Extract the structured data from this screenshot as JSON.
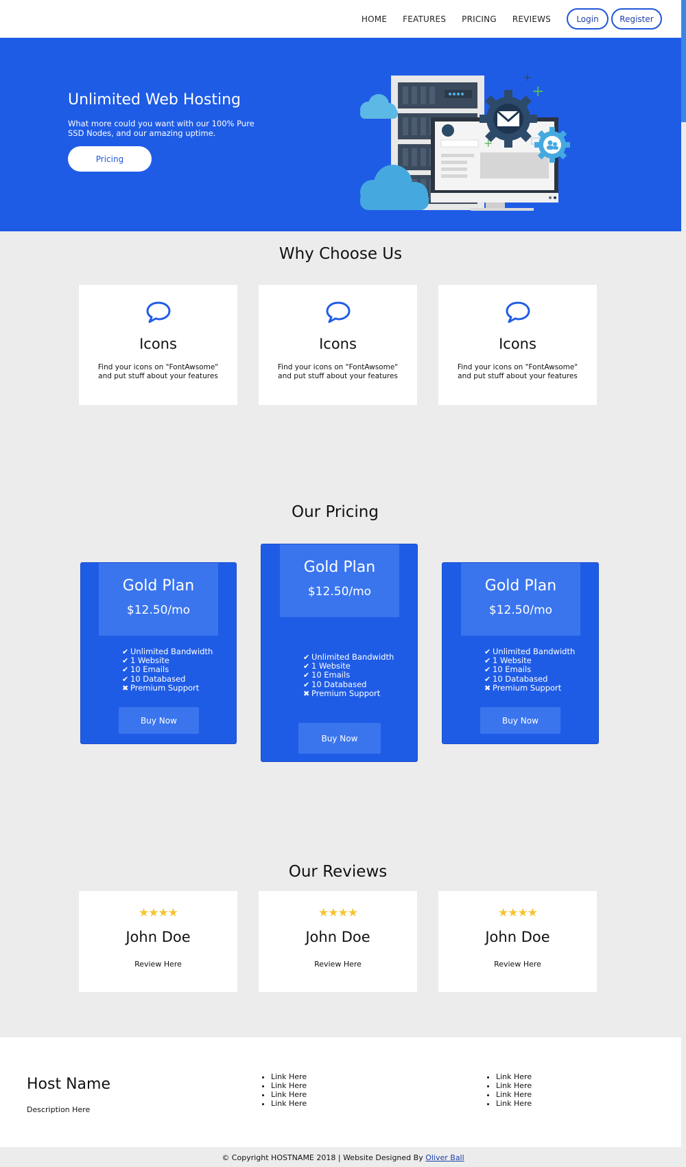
{
  "nav": {
    "links": [
      "HOME",
      "FEATURES",
      "PRICING",
      "REVIEWS"
    ],
    "login": "Login",
    "register": "Register"
  },
  "hero": {
    "title": "Unlimited Web Hosting",
    "description": "What more could you want with our 100% Pure SSD Nodes, and our amazing uptime.",
    "button": "Pricing"
  },
  "why": {
    "title": "Why Choose Us",
    "cards": [
      {
        "title": "Icons",
        "description": "Find your icons on \"FontAwsome\" and put stuff about your features"
      },
      {
        "title": "Icons",
        "description": "Find your icons on \"FontAwsome\" and put stuff about your features"
      },
      {
        "title": "Icons",
        "description": "Find your icons on \"FontAwsome\" and put stuff about your features"
      }
    ]
  },
  "pricing": {
    "title": "Our Pricing",
    "plans": [
      {
        "name": "Gold Plan",
        "price": "$12.50/mo",
        "features": [
          "Unlimited Bandwidth",
          "1 Website",
          "10 Emails",
          "10 Databased",
          "Premium Support"
        ],
        "button": "Buy Now"
      },
      {
        "name": "Gold Plan",
        "price": "$12.50/mo",
        "features": [
          "Unlimited Bandwidth",
          "1 Website",
          "10 Emails",
          "10 Databased",
          "Premium Support"
        ],
        "button": "Buy Now"
      },
      {
        "name": "Gold Plan",
        "price": "$12.50/mo",
        "features": [
          "Unlimited Bandwidth",
          "1 Website",
          "10 Emails",
          "10 Databased",
          "Premium Support"
        ],
        "button": "Buy Now"
      }
    ]
  },
  "reviews": {
    "title": "Our Reviews",
    "items": [
      {
        "stars": "★★★★",
        "name": "John Doe",
        "text": "Review Here"
      },
      {
        "stars": "★★★★",
        "name": "John Doe",
        "text": "Review Here"
      },
      {
        "stars": "★★★★",
        "name": "John Doe",
        "text": "Review Here"
      }
    ]
  },
  "footer": {
    "host_name": "Host Name",
    "description": "Description Here",
    "links_col1": [
      "Link Here",
      "Link Here",
      "Link Here",
      "Link Here"
    ],
    "links_col2": [
      "Link Here",
      "Link Here",
      "Link Here",
      "Link Here"
    ],
    "copyright_prefix": "© Copyright HOSTNAME 2018 | Website Designed By ",
    "designer": "Oliver Ball"
  },
  "colors": {
    "primary": "#1f5ce6",
    "plan_header": "#3a75ee",
    "star": "#f4c531",
    "background": "#ececec"
  }
}
